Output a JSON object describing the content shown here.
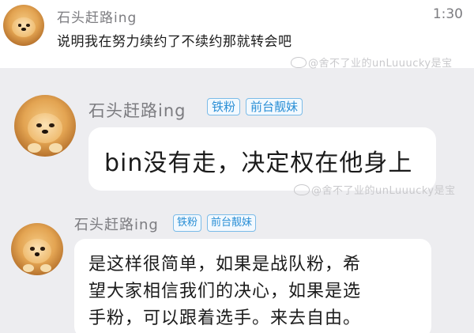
{
  "post1": {
    "username": "石头赶路ing",
    "time": "1:30",
    "message": "说明我在努力续约了不续约那就转会吧",
    "watermark": "@舍不了业的unLuuucky是宝"
  },
  "post2": {
    "username": "石头赶路ing",
    "badges": [
      "铁粉",
      "前台靓妹"
    ],
    "message": "bin没有走，决定权在他身上",
    "watermark": "@舍不了业的unLuuucky是宝"
  },
  "post3": {
    "username": "石头赶路ing",
    "badges": [
      "铁粉",
      "前台靓妹"
    ],
    "message_lines": [
      "是这样很简单，如果是战队粉，希",
      "望大家相信我们的决心，如果是选",
      "手粉，可以跟着选手。来去自由。"
    ]
  },
  "colors": {
    "badge_text": "#2a8fd6",
    "badge_border": "#7bbbe8",
    "name_gray": "#7c7c80",
    "background": "#ededf0"
  },
  "icons": {
    "avatar": "pomeranian-dog-avatar",
    "watermark_logo": "weibo-logo-icon"
  }
}
